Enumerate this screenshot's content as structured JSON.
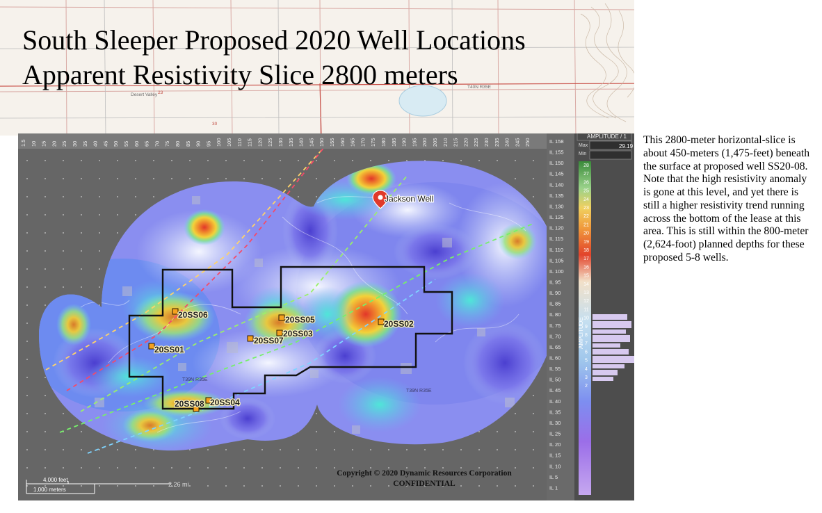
{
  "title": {
    "line1": "South Sleeper Proposed 2020 Well Locations",
    "line2": "Apparent Resistivity  Slice 2800 meters"
  },
  "description": "This 2800-meter horizontal-slice is about 450-meters (1,475-feet) beneath the surface at proposed well SS20-08. Note that the high resistivity anomaly is gone at this level, and yet there is still a higher resistivity trend running  across the bottom  of the lease at this area. This is still within the 800-meter (2,624-foot) planned depths for these proposed 5-8 wells.",
  "base_map": {
    "labels": {
      "desert_valley": "Desert Valley",
      "twp_top": "T40N R35E",
      "twp_mid": "T39N R35E",
      "twp_right": "T39N R35E",
      "section_23": "23",
      "section_30": "30"
    }
  },
  "wells": [
    {
      "name": "20SS06"
    },
    {
      "name": "20SS01"
    },
    {
      "name": "20SS05"
    },
    {
      "name": "20SS03"
    },
    {
      "name": "20SS07"
    },
    {
      "name": "20SS02"
    },
    {
      "name": "20SS08"
    },
    {
      "name": "20SS04"
    }
  ],
  "landmark": {
    "name": "Jackson Well"
  },
  "grid": {
    "inline_labels": [
      "IL 158",
      "IL 155",
      "IL 150",
      "IL 145",
      "IL 140",
      "IL 135",
      "IL 130",
      "IL 125",
      "IL 120",
      "IL 115",
      "IL 110",
      "IL 105",
      "IL 100",
      "IL 95",
      "IL 90",
      "IL 85",
      "IL 80",
      "IL 75",
      "IL 70",
      "IL 65",
      "IL 60",
      "IL 55",
      "IL 50",
      "IL 45",
      "IL 40",
      "IL 35",
      "IL 30",
      "IL 25",
      "IL 20",
      "IL 15",
      "IL 10",
      "IL 5",
      "IL 1"
    ],
    "xline_labels": [
      "1.5",
      "10",
      "15",
      "20",
      "25",
      "30",
      "35",
      "40",
      "45",
      "50",
      "55",
      "60",
      "65",
      "70",
      "75",
      "80",
      "85",
      "90",
      "95",
      "100",
      "105",
      "110",
      "115",
      "120",
      "125",
      "130",
      "135",
      "140",
      "145",
      "150",
      "155",
      "160",
      "165",
      "170",
      "175",
      "180",
      "185",
      "190",
      "195",
      "200",
      "205",
      "210",
      "215",
      "220",
      "225",
      "230",
      "235",
      "240",
      "245",
      "250"
    ]
  },
  "amplitude_panel": {
    "header": "AMPLITUDE / 1",
    "min_label": "Min",
    "max_label": "Max",
    "max_value": "29.19",
    "axis_label": "AMPLITUDE",
    "ticks": [
      "28",
      "27",
      "26",
      "25",
      "24",
      "23",
      "22",
      "21",
      "20",
      "19",
      "18",
      "17",
      "16",
      "15",
      "14",
      "13",
      "12",
      "11",
      "10",
      "9",
      "8",
      "7",
      "6",
      "5",
      "4",
      "3",
      "2"
    ]
  },
  "scale_bar": {
    "feet": "4,000 feet",
    "meters": "1,000 meters",
    "distance_readout": "2.26 mi"
  },
  "copyright": {
    "line1": "Copyright  © 2020 Dynamic Resources Corporation",
    "line2": "CONFIDENTIAL"
  },
  "colors": {
    "high_resistivity": "#e8402a",
    "mid_resistivity": "#f2c230",
    "low_resistivity": "#4a5fe0",
    "background_gray": "#646464",
    "lease_outline": "#111111",
    "well_marker": "#f5a11e"
  }
}
